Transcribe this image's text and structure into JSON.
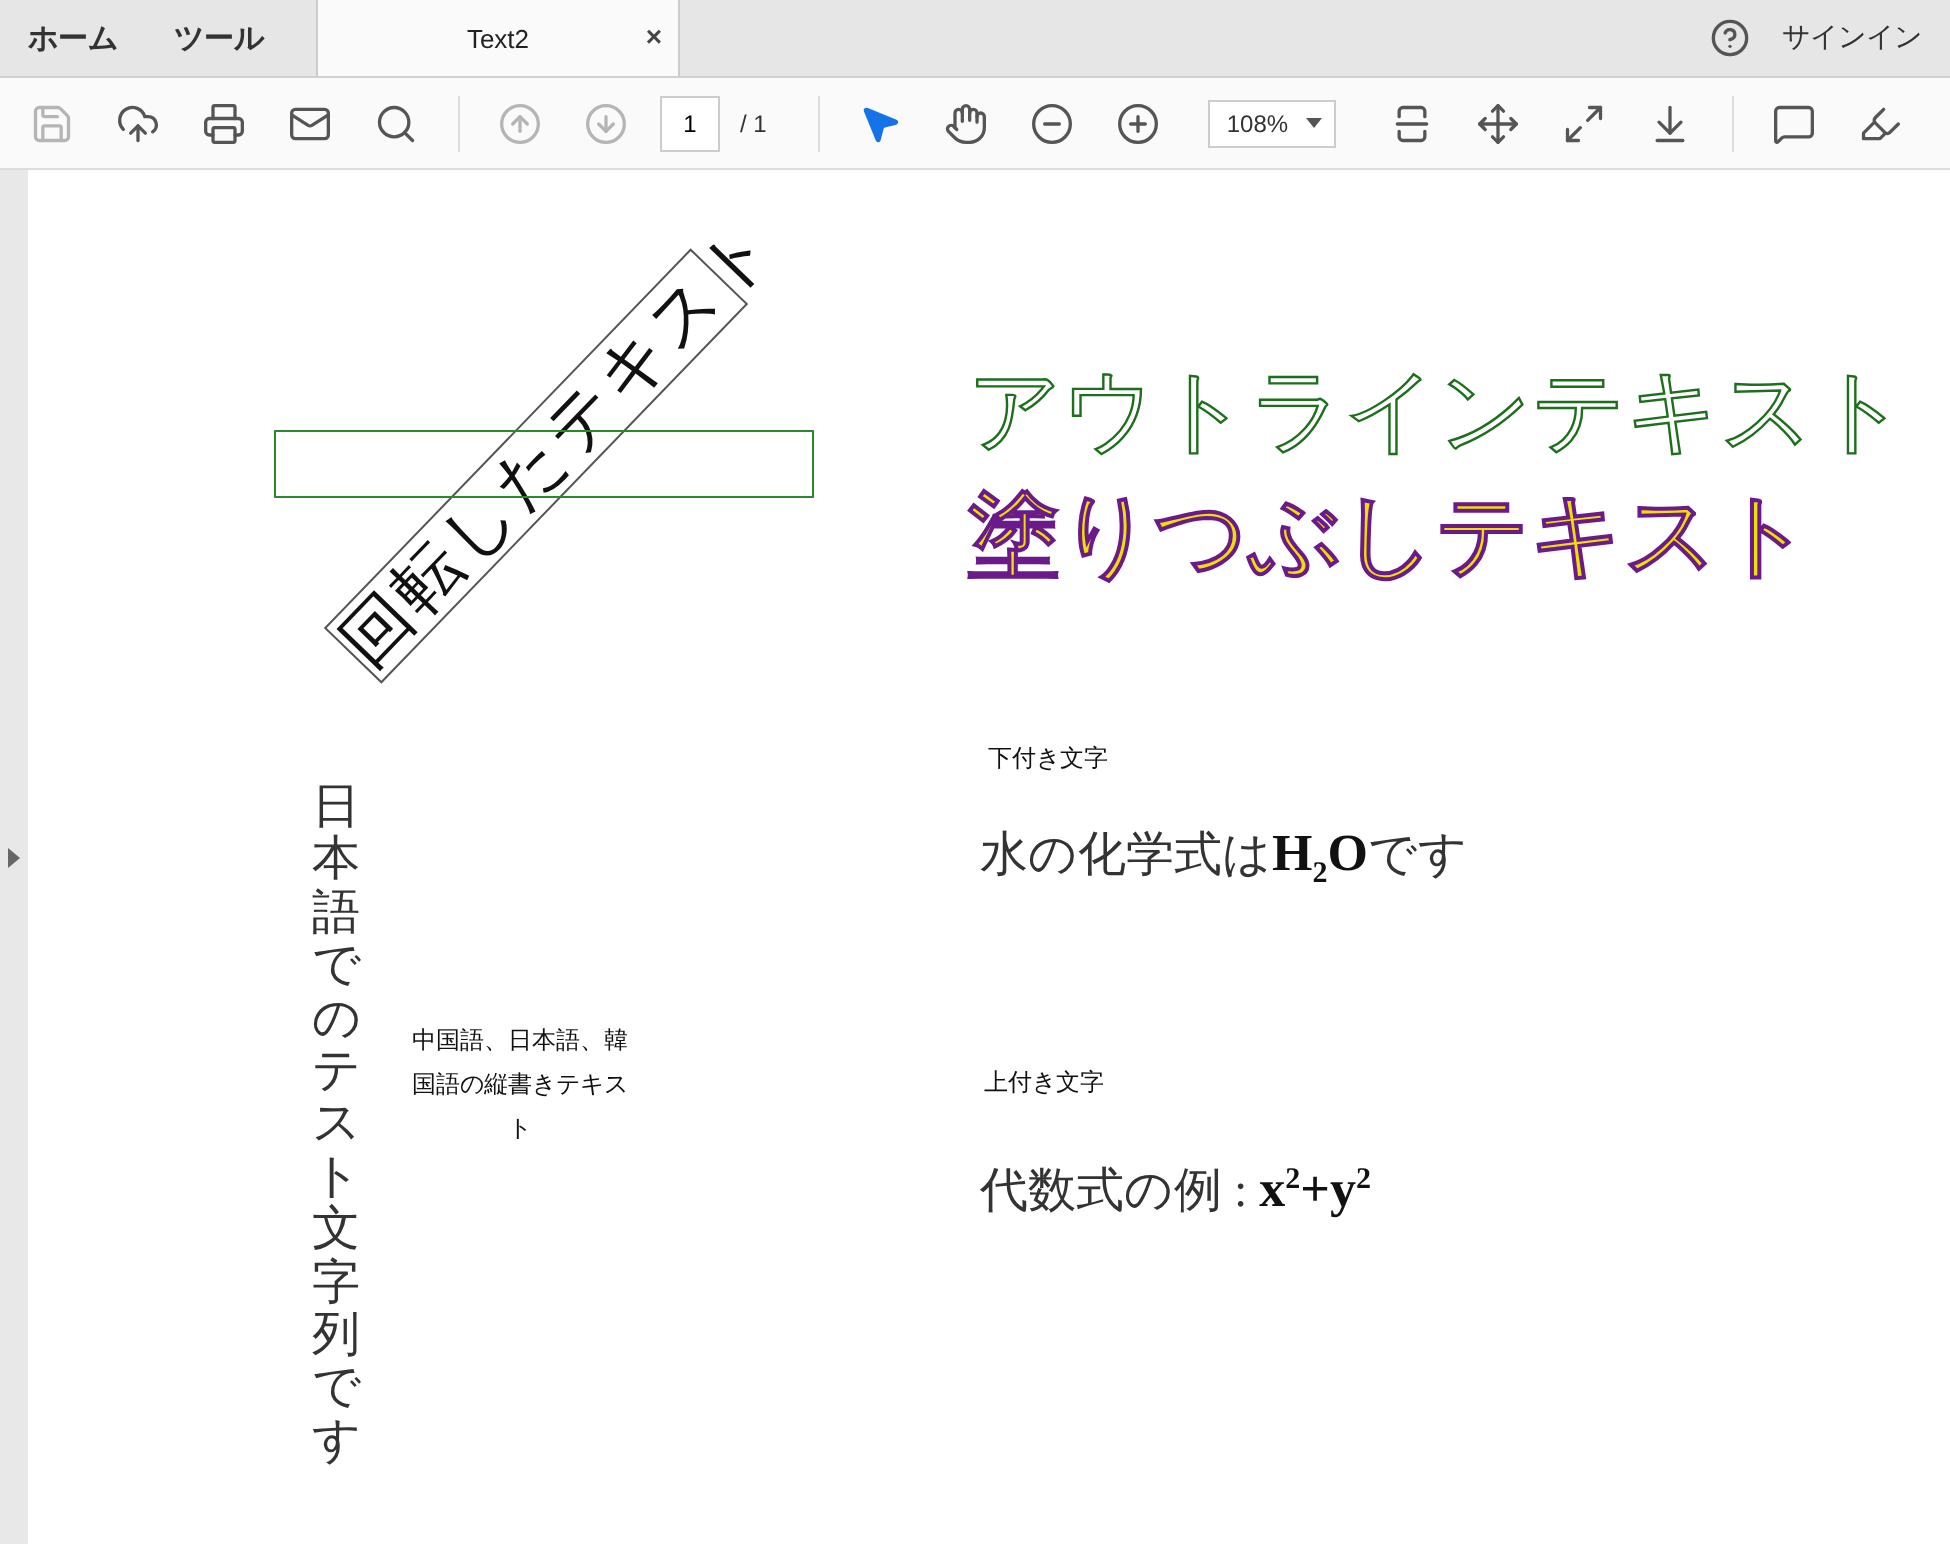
{
  "tabs": [
    {
      "kind": "nav",
      "label": "ホーム",
      "selected": false
    },
    {
      "kind": "nav",
      "label": "ツール",
      "selected": false
    },
    {
      "kind": "document",
      "label": "Text2",
      "selected": true,
      "close": "×"
    }
  ],
  "header": {
    "sign_in": "サインイン"
  },
  "toolbar": {
    "file_tools": [
      {
        "kind": "save",
        "disabled": true
      },
      {
        "kind": "upload",
        "disabled": false
      },
      {
        "kind": "print",
        "disabled": false
      },
      {
        "kind": "mail",
        "disabled": false
      },
      {
        "kind": "search",
        "disabled": false
      }
    ],
    "nav_tools": [
      {
        "kind": "up",
        "disabled": true
      },
      {
        "kind": "down",
        "disabled": true
      }
    ],
    "page_input": "1",
    "page_total": "/ 1",
    "view_tools": [
      {
        "kind": "pointer",
        "selected": true
      },
      {
        "kind": "hand",
        "selected": false
      },
      {
        "kind": "zoom_out",
        "selected": false
      },
      {
        "kind": "zoom_in",
        "selected": false
      }
    ],
    "zoom": "108%",
    "layout_tools": [
      {
        "kind": "fit_width"
      },
      {
        "kind": "fit_page"
      },
      {
        "kind": "full_screen"
      },
      {
        "kind": "scroll"
      }
    ],
    "markup_tools": [
      {
        "kind": "comment"
      },
      {
        "kind": "highlight"
      }
    ]
  },
  "document": {
    "rotated_text": "回転したテキスト",
    "outline_text": "アウトラインテキスト",
    "fill_text": "塗りつぶしテキスト",
    "vertical_text": "日本語でのテスト文字列です",
    "wrapped_text": "中国語、日本語、韓国語の縦書きテキスト",
    "subscript_label": "下付き文字",
    "subscript_example": "水の化学式は**H**$_{2}$**O**です",
    "superscript_label": "上付き文字",
    "superscript_example": "代数式の例 : **x**$^{2}$**+y**$^{2}$"
  }
}
